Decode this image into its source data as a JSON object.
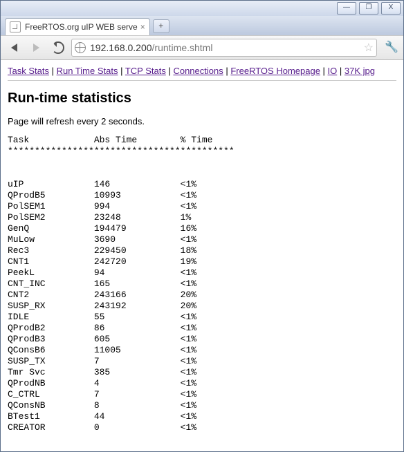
{
  "window": {
    "btn_min": "—",
    "btn_max": "❐",
    "btn_close": "X"
  },
  "tab": {
    "title": "FreeRTOS.org uIP WEB serve",
    "close": "×",
    "newtab": "+"
  },
  "toolbar": {
    "url_host": "192.168.0.200",
    "url_path": "/runtime.shtml",
    "star": "☆",
    "wrench": "🔧"
  },
  "nav": {
    "sep": " | ",
    "links": [
      "Task Stats",
      "Run Time Stats",
      "TCP Stats",
      "Connections",
      "FreeRTOS Homepage",
      "IO",
      "37K jpg"
    ]
  },
  "page": {
    "heading": "Run-time statistics",
    "refresh_note": "Page will refresh every 2 seconds.",
    "col_task": "Task",
    "col_abs": "Abs Time",
    "col_pct": "% Time",
    "ruler": "******************************************"
  },
  "chart_data": {
    "type": "table",
    "columns": [
      "Task",
      "Abs Time",
      "% Time"
    ],
    "rows": [
      {
        "task": "uIP",
        "abs": "146",
        "pct": "<1%"
      },
      {
        "task": "QProdB5",
        "abs": "10993",
        "pct": "<1%"
      },
      {
        "task": "PolSEM1",
        "abs": "994",
        "pct": "<1%"
      },
      {
        "task": "PolSEM2",
        "abs": "23248",
        "pct": "1%"
      },
      {
        "task": "GenQ",
        "abs": "194479",
        "pct": "16%"
      },
      {
        "task": "MuLow",
        "abs": "3690",
        "pct": "<1%"
      },
      {
        "task": "Rec3",
        "abs": "229450",
        "pct": "18%"
      },
      {
        "task": "CNT1",
        "abs": "242720",
        "pct": "19%"
      },
      {
        "task": "PeekL",
        "abs": "94",
        "pct": "<1%"
      },
      {
        "task": "CNT_INC",
        "abs": "165",
        "pct": "<1%"
      },
      {
        "task": "CNT2",
        "abs": "243166",
        "pct": "20%"
      },
      {
        "task": "SUSP_RX",
        "abs": "243192",
        "pct": "20%"
      },
      {
        "task": "IDLE",
        "abs": "55",
        "pct": "<1%"
      },
      {
        "task": "QProdB2",
        "abs": "86",
        "pct": "<1%"
      },
      {
        "task": "QProdB3",
        "abs": "605",
        "pct": "<1%"
      },
      {
        "task": "QConsB6",
        "abs": "11005",
        "pct": "<1%"
      },
      {
        "task": "SUSP_TX",
        "abs": "7",
        "pct": "<1%"
      },
      {
        "task": "Tmr Svc",
        "abs": "385",
        "pct": "<1%"
      },
      {
        "task": "QProdNB",
        "abs": "4",
        "pct": "<1%"
      },
      {
        "task": "C_CTRL",
        "abs": "7",
        "pct": "<1%"
      },
      {
        "task": "QConsNB",
        "abs": "8",
        "pct": "<1%"
      },
      {
        "task": "BTest1",
        "abs": "44",
        "pct": "<1%"
      },
      {
        "task": "CREATOR",
        "abs": "0",
        "pct": "<1%"
      }
    ]
  }
}
